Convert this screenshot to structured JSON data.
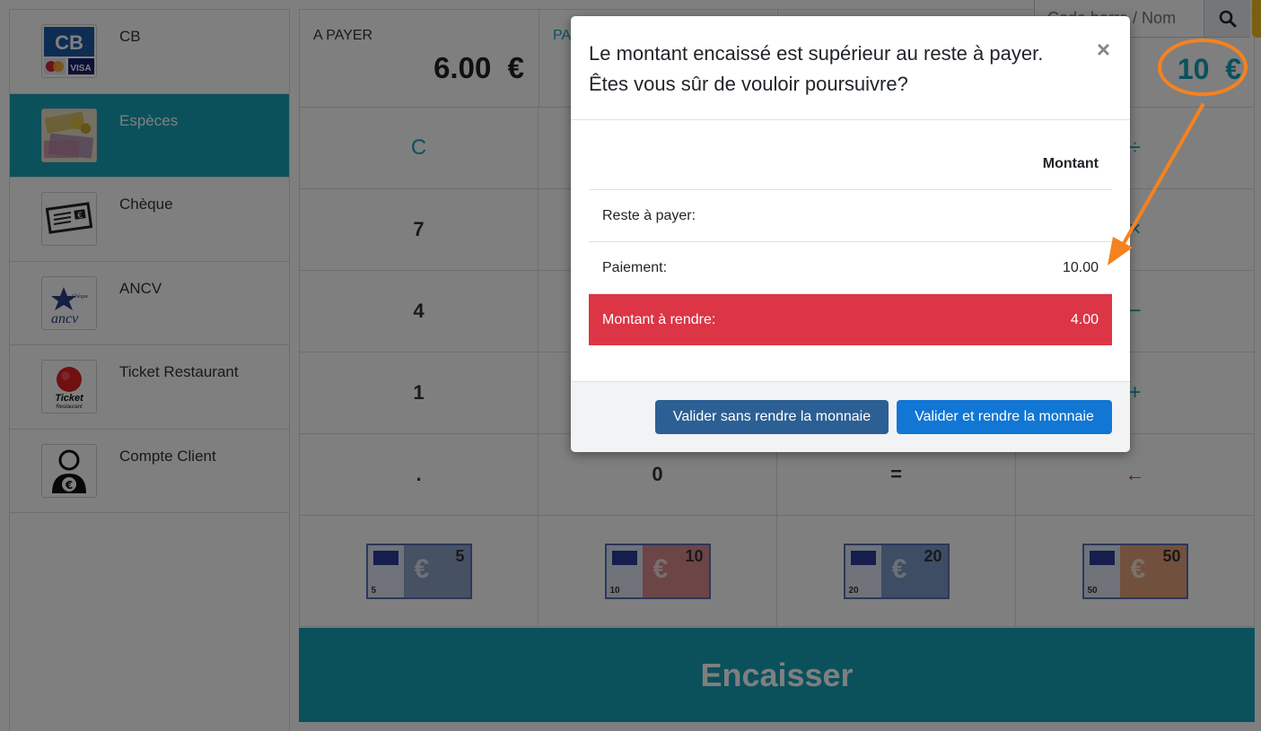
{
  "payment_methods": [
    {
      "label": "CB",
      "icon": "cb-card-icon",
      "active": false
    },
    {
      "label": "Espèces",
      "icon": "cash-icon",
      "active": true
    },
    {
      "label": "Chèque",
      "icon": "cheque-icon",
      "active": false
    },
    {
      "label": "ANCV",
      "icon": "ancv-icon",
      "active": false
    },
    {
      "label": "Ticket Restaurant",
      "icon": "ticket-restaurant-icon",
      "active": false
    },
    {
      "label": "Compte Client",
      "icon": "customer-account-icon",
      "active": false
    }
  ],
  "top": {
    "to_pay_label": "A PAYER",
    "to_pay_value": "6.00  €",
    "paid_label": "PA",
    "entered_value": "10  €"
  },
  "search": {
    "placeholder": "Code barre / Nom"
  },
  "keypad": {
    "row1": [
      "C",
      "",
      "",
      "÷"
    ],
    "row2": [
      "7",
      "",
      "",
      "×"
    ],
    "row3": [
      "4",
      "",
      "",
      "−"
    ],
    "row4": [
      "1",
      "",
      "",
      "+"
    ],
    "row5": [
      ".",
      "0",
      "=",
      "←"
    ]
  },
  "banknotes": [
    "5",
    "10",
    "20",
    "50"
  ],
  "encaisser_label": "Encaisser",
  "modal": {
    "title": "Le montant encaissé est supérieur au reste à payer. Êtes vous sûr de vouloir poursuivre?",
    "close": "×",
    "column_header": "Montant",
    "rows": [
      {
        "label": "Reste à payer:",
        "value": ""
      },
      {
        "label": "Paiement:",
        "value": "10.00"
      },
      {
        "label": "Montant à rendre:",
        "value": "4.00"
      }
    ],
    "btn_no_change": "Valider sans rendre la monnaie",
    "btn_with_change": "Valider et rendre la monnaie"
  },
  "colors": {
    "teal": "#17a2b8",
    "danger": "#dc3545",
    "annotation": "#f58220",
    "btn_dark_blue": "#2c5f93",
    "btn_blue": "#1176d4"
  }
}
